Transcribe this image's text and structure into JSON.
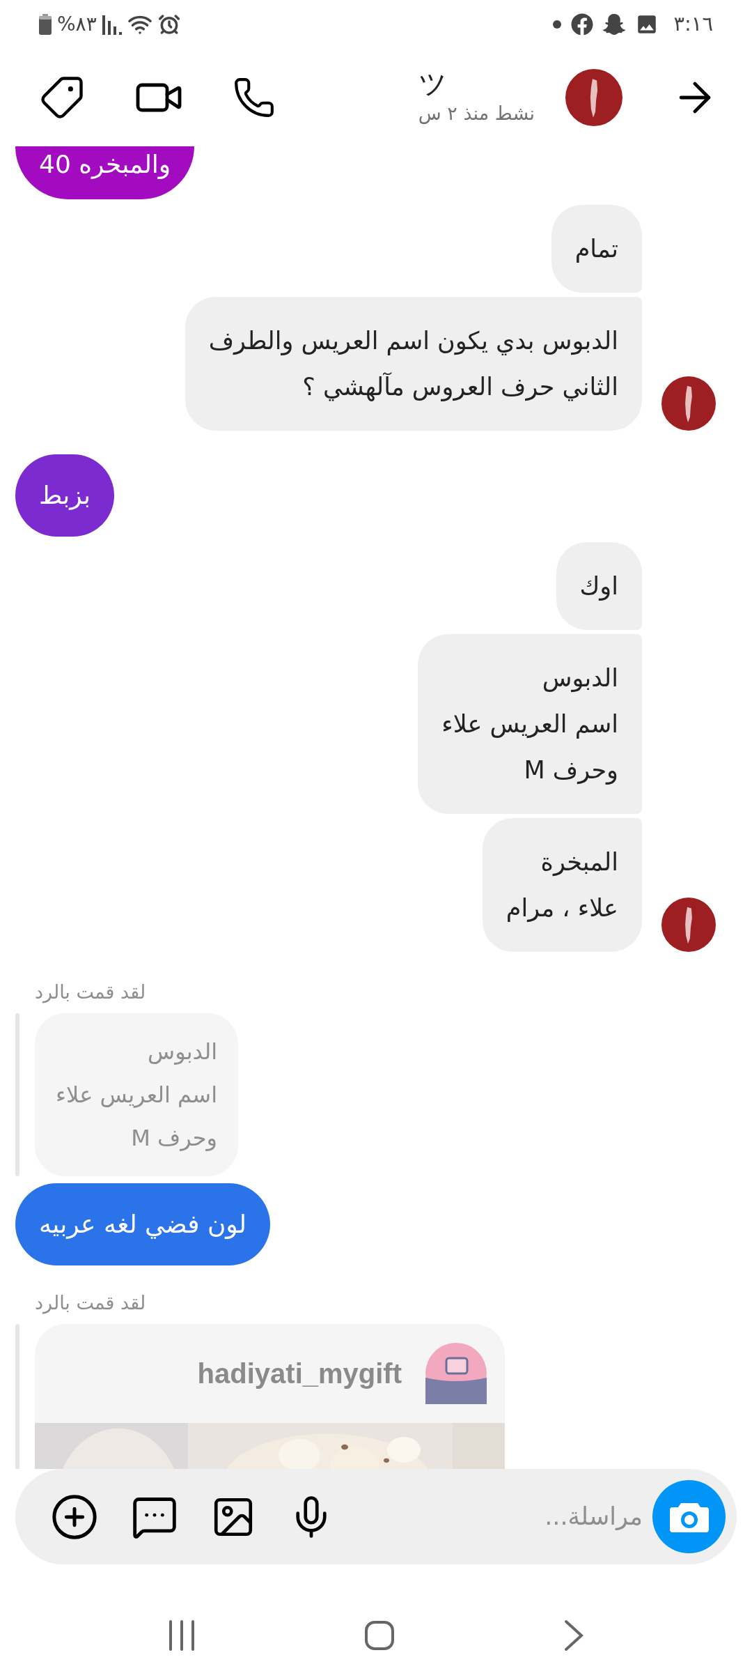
{
  "status_bar": {
    "time": "٣:١٦",
    "battery": "%٨٣"
  },
  "header": {
    "name": "ツ",
    "activity": "نشط منذ ٢ س"
  },
  "messages": [
    {
      "kind": "sent",
      "text": "والمبخره 40",
      "color": "#a20bbf"
    },
    {
      "kind": "received",
      "text": "تمام",
      "avatar": false
    },
    {
      "kind": "received",
      "text": "الدبوس بدي يكون اسم العريس والطرف\nالثاني حرف العروس مآلهشي ؟",
      "avatar": true
    },
    {
      "kind": "sent",
      "text": "بزبط",
      "color": "#7b2bd0"
    },
    {
      "kind": "received",
      "text": "اوك",
      "avatar": false
    },
    {
      "kind": "received",
      "text": "الدبوس\nاسم العريس علاء\nوحرف M",
      "avatar": false
    },
    {
      "kind": "received",
      "text": "المبخرة\nعلاء ، مرام",
      "avatar": true
    },
    {
      "kind": "reply",
      "label": "لقد قمت بالرد",
      "quote": "الدبوس\nاسم العريس علاء\nوحرف M"
    },
    {
      "kind": "sent",
      "text": "لون فضي لغه عربيه",
      "color": "#2a73e8"
    },
    {
      "kind": "shared_post",
      "label": "لقد قمت بالرد",
      "username": "hadiyati_mygift"
    }
  ],
  "composer": {
    "placeholder": "مراسلة..."
  }
}
